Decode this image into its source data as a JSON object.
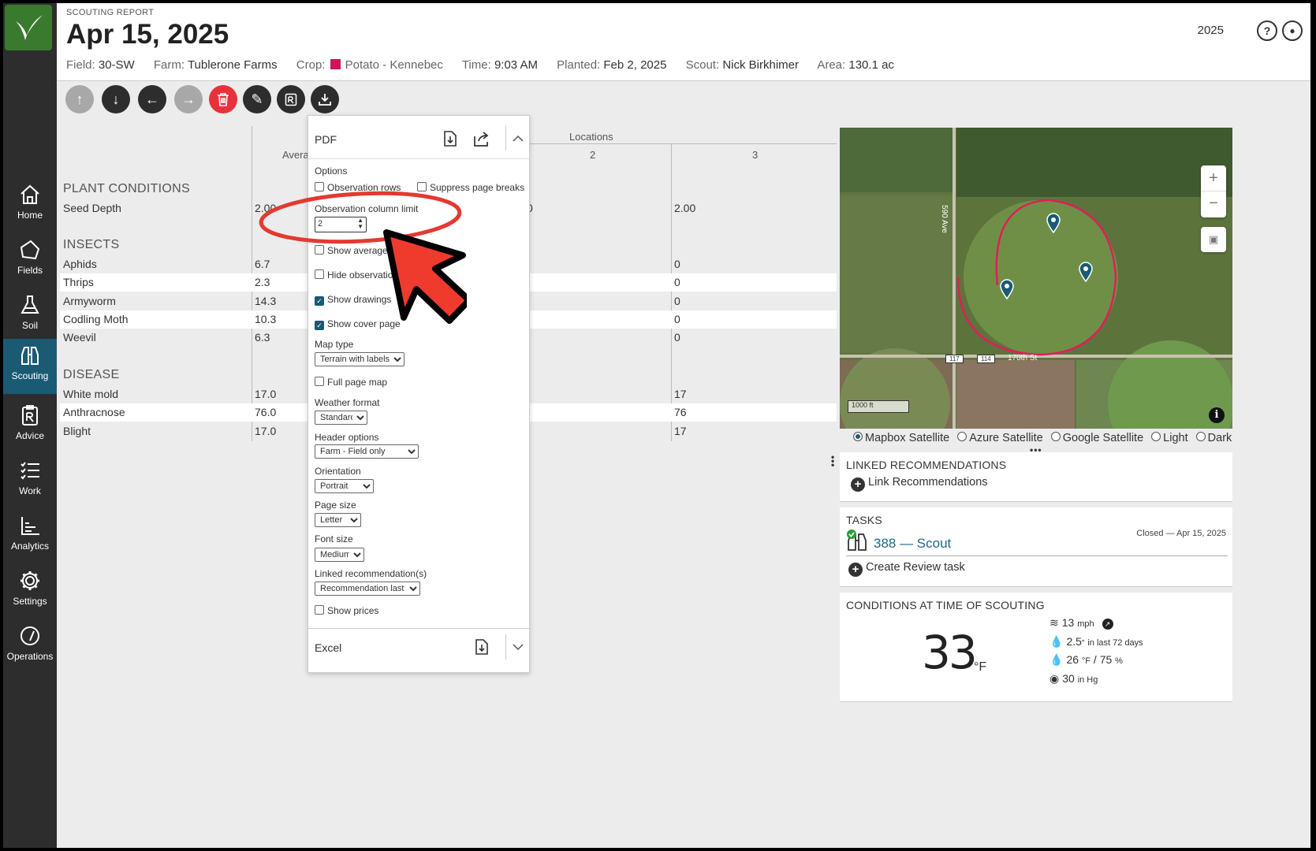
{
  "nav": {
    "items": [
      {
        "label": "Home"
      },
      {
        "label": "Fields"
      },
      {
        "label": "Soil"
      },
      {
        "label": "Scouting"
      },
      {
        "label": "Advice"
      },
      {
        "label": "Work"
      },
      {
        "label": "Analytics"
      },
      {
        "label": "Settings"
      },
      {
        "label": "Operations"
      }
    ]
  },
  "header": {
    "subtitle": "SCOUTING REPORT",
    "title": "Apr 15, 2025",
    "year": "2025",
    "meta": {
      "field_k": "Field:",
      "field_v": "30-SW",
      "farm_k": "Farm:",
      "farm_v": "Tublerone Farms",
      "crop_k": "Crop:",
      "crop_v": "Potato - Kennebec",
      "time_k": "Time:",
      "time_v": "9:03 AM",
      "planted_k": "Planted:",
      "planted_v": "Feb 2, 2025",
      "scout_k": "Scout:",
      "scout_v": "Nick Birkhimer",
      "area_k": "Area:",
      "area_v": "130.1 ac"
    },
    "crop_color": "#d0135a"
  },
  "table": {
    "locations_label": "Locations",
    "avg_label": "Avera",
    "col2": "2",
    "col3": "3",
    "seed_avg": "2.00",
    "seed_col2": "0",
    "sections": [
      {
        "title": "PLANT CONDITIONS",
        "rows": [
          {
            "name": "Seed Depth",
            "avg": "2.00",
            "loc3": "2.00"
          }
        ]
      },
      {
        "title": "INSECTS",
        "rows": [
          {
            "name": "Aphids",
            "avg": "6.7",
            "loc3": "0"
          },
          {
            "name": "Thrips",
            "avg": "2.3",
            "loc3": "0"
          },
          {
            "name": "Armyworm",
            "avg": "14.3",
            "loc3": "0"
          },
          {
            "name": "Codling Moth",
            "avg": "10.3",
            "loc3": "0"
          },
          {
            "name": "Weevil",
            "avg": "6.3",
            "loc3": "0"
          }
        ]
      },
      {
        "title": "DISEASE",
        "rows": [
          {
            "name": "White mold",
            "avg": "17.0",
            "loc3": "17"
          },
          {
            "name": "Anthracnose",
            "avg": "76.0",
            "loc3": "76"
          },
          {
            "name": "Blight",
            "avg": "17.0",
            "loc3": "17"
          }
        ]
      }
    ]
  },
  "pdf_panel": {
    "title": "PDF",
    "options_label": "Options",
    "opt1": "Observation rows",
    "opt2": "Suppress page breaks",
    "obs_limit_label": "Observation column limit",
    "obs_limit_value": "2",
    "show_averages": "Show averages",
    "hide_observations": "Hide observations",
    "show_drawings": "Show drawings",
    "show_cover": "Show cover page",
    "map_type_label": "Map type",
    "map_type_value": "Terrain with labels",
    "full_page_map": "Full page map",
    "weather_label": "Weather format",
    "weather_value": "Standard",
    "header_label": "Header options",
    "header_value": "Farm - Field only",
    "orientation_label": "Orientation",
    "orientation_value": "Portrait",
    "page_size_label": "Page size",
    "page_size_value": "Letter",
    "font_size_label": "Font size",
    "font_size_value": "Medium",
    "linked_label": "Linked recommendation(s)",
    "linked_value": "Recommendation last",
    "show_prices": "Show prices",
    "excel_label": "Excel"
  },
  "map": {
    "road1": "590 Ave",
    "road2": "170th St",
    "shield1": "117",
    "shield2": "114",
    "scale": "1000 ft",
    "layers": [
      "Mapbox Satellite",
      "Azure Satellite",
      "Google Satellite",
      "Light",
      "Dark"
    ],
    "selected_layer": "Mapbox Satellite"
  },
  "linked": {
    "title": "LINKED RECOMMENDATIONS",
    "action": "Link Recommendations"
  },
  "tasks": {
    "title": "TASKS",
    "task": "388 — Scout",
    "status": "Closed — Apr 15, 2025",
    "action": "Create Review task"
  },
  "conditions": {
    "title": "CONDITIONS AT TIME OF SCOUTING",
    "temp": "33",
    "temp_unit": "°F",
    "wind": "13",
    "wind_unit": "mph",
    "rain": "2.5",
    "rain_unit": "\"",
    "rain_note": "in last 72 days",
    "dew": "26",
    "dew_unit": "°F",
    "humidity": "/ 75",
    "humidity_unit": "%",
    "pressure": "30",
    "pressure_unit": "in Hg"
  }
}
